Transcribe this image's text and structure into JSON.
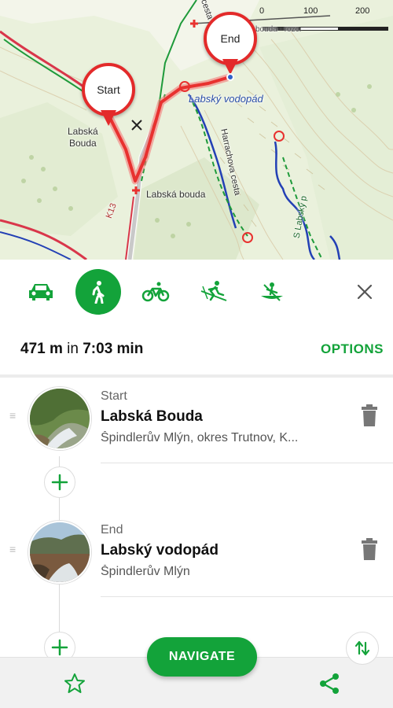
{
  "map": {
    "scale": {
      "ticks": [
        "0",
        "100",
        "200"
      ]
    },
    "labels": {
      "labska_bouda_left": "Labská\nBouda",
      "labska_bouda_road": "Labská bouda",
      "labsky_vodopad": "Labský vodopád",
      "road_k13": "K13",
      "harrachova_cesta": "Harrachova cesta",
      "labsky_pohled": "S Labský p",
      "cesta_top": "cesta",
      "bouda_top": "bouda - rozc."
    },
    "pins": {
      "start": "Start",
      "end": "End"
    },
    "colors": {
      "route": "#e8312f",
      "trail_blue": "#2340b5",
      "trail_green": "#1e9a3a",
      "road": "#d9364a"
    }
  },
  "modes": {
    "items": [
      {
        "name": "car",
        "icon": "car-icon",
        "active": false
      },
      {
        "name": "walk",
        "icon": "walk-icon",
        "active": true
      },
      {
        "name": "bike",
        "icon": "bike-icon",
        "active": false
      },
      {
        "name": "ski",
        "icon": "ski-icon",
        "active": false
      },
      {
        "name": "canoe",
        "icon": "canoe-icon",
        "active": false
      }
    ],
    "close_icon": "close-icon"
  },
  "summary": {
    "distance": "471 m",
    "connector": "in",
    "duration": "7:03 min",
    "options_label": "OPTIONS"
  },
  "stops": [
    {
      "type": "Start",
      "name": "Labská Bouda",
      "address": "Špindlerův Mlýn, okres Trutnov, K..."
    },
    {
      "type": "End",
      "name": "Labský vodopád",
      "address": "Špindlerův Mlýn"
    }
  ],
  "actions": {
    "navigate_label": "NAVIGATE"
  },
  "bottom_bar": {
    "icons": [
      "star-icon",
      "share-icon"
    ]
  },
  "accent_color": "#13a33a"
}
